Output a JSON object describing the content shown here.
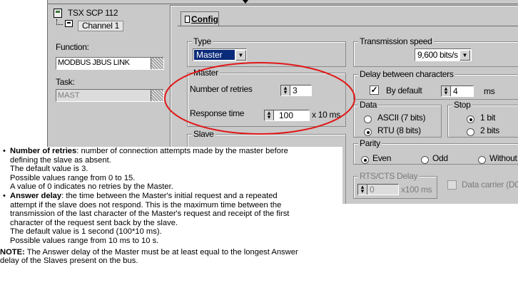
{
  "window": {
    "module": "TSX SCP 112",
    "channel": "Channel 1",
    "function_label": "Function:",
    "function_value": "MODBUS JBUS LINK",
    "task_label": "Task:",
    "task_value": "MAST",
    "tab_label": "Config"
  },
  "type_group": {
    "legend": "Type",
    "value": "Master"
  },
  "master_group": {
    "legend": "Master",
    "retries_label": "Number of retries",
    "retries_value": "3",
    "response_label": "Response time",
    "response_value": "100",
    "response_unit": "x 10 ms"
  },
  "slave_group": {
    "legend": "Slave"
  },
  "transmission": {
    "legend": "Transmission speed",
    "value": "9,600 bits/s"
  },
  "delay": {
    "legend": "Delay between characters",
    "default_label": "By default",
    "default_checked": true,
    "value": "4",
    "unit": "ms"
  },
  "data_group": {
    "legend": "Data",
    "opt1": "ASCII (7 bits)",
    "opt2": "RTU (8 bits)",
    "selected": "opt2"
  },
  "stop_group": {
    "legend": "Stop",
    "opt1": "1 bit",
    "opt2": "2 bits",
    "selected": "opt1"
  },
  "parity_group": {
    "legend": "Parity",
    "opt1": "Even",
    "opt2": "Odd",
    "opt3": "Without",
    "selected": "opt1"
  },
  "rts_group": {
    "legend": "RTS/CTS Delay",
    "value": "0",
    "unit": "x100 ms"
  },
  "carrier": {
    "label": "Data carrier (DCD)"
  },
  "doc": {
    "item1_title": "Number of retries",
    "item1_line1": ": number of connection attempts made by the master before",
    "item1_line2": "defining the slave as absent.",
    "item1_line3": "The default value is 3.",
    "item1_line4": "Possible values range from 0 to 15.",
    "item1_line5": "A value of 0 indicates no retries by the Master.",
    "item2_title": "Answer delay",
    "item2_line1": ": the time between the Master's initial request and a repeated",
    "item2_line2": "attempt if the slave does not respond. This is the maximum time between the",
    "item2_line3": "transmission of the last character of the Master's request and receipt of the first",
    "item2_line4": "character of the request sent back by the slave.",
    "item2_line5": "The default value is 1 second (100*10 ms).",
    "item2_line6": "Possible values range from 10 ms to 10 s.",
    "note_label": "NOTE:",
    "note_line1": " The Answer delay of the Master must be at least equal to the longest Answer",
    "note_line2": "delay of the Slaves present on the bus."
  },
  "colors": {
    "highlight_ring": "#e01818",
    "selection": "#0a2a7a",
    "panel": "#c9c9c9"
  }
}
